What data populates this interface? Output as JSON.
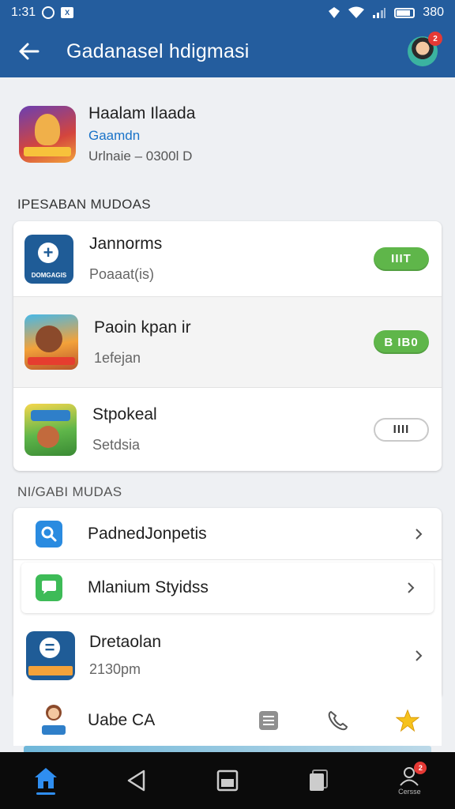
{
  "status_bar": {
    "time": "1:31",
    "battery": "380",
    "notif_icon": "X"
  },
  "app_bar": {
    "title": "Gadanasel hdigmasi",
    "avatar_badge": "2"
  },
  "featured": {
    "name": "Haalam Ilaada",
    "developer": "Gaamdn",
    "meta": "Urlnaie – 0300l D"
  },
  "section1": {
    "label": "IPESABAN MUDOAS"
  },
  "apps": [
    {
      "title": "Jannorms",
      "subtitle": "Poaaat(is)",
      "icon_label": "DOMGAGIS",
      "button": "IIIT",
      "button_style": "green"
    },
    {
      "title": "Paoin kpan ir",
      "subtitle": "1efejan",
      "button": "B IB0",
      "button_style": "green"
    },
    {
      "title": "Stpokeal",
      "subtitle": "Setdsia",
      "button": "IIII",
      "button_style": "outline"
    }
  ],
  "section2": {
    "label": "NI/GABI MUDAS"
  },
  "menu": [
    {
      "title": "PadnedJonpetis",
      "icon": "search-icon"
    },
    {
      "title": "Mlanium Styidss",
      "icon": "chat-icon"
    },
    {
      "title": "Dretaolan",
      "subtitle": "2130pm",
      "icon": "app-icon"
    }
  ],
  "bottom_row": {
    "title": "Uabe CA"
  },
  "nav": {
    "profile_label": "Cersse",
    "profile_badge": "2"
  },
  "colors": {
    "app_bar": "#245d9e",
    "accent_green": "#5fb64a",
    "link_blue": "#1a73c8",
    "nav_bar": "#0b0b0b"
  }
}
